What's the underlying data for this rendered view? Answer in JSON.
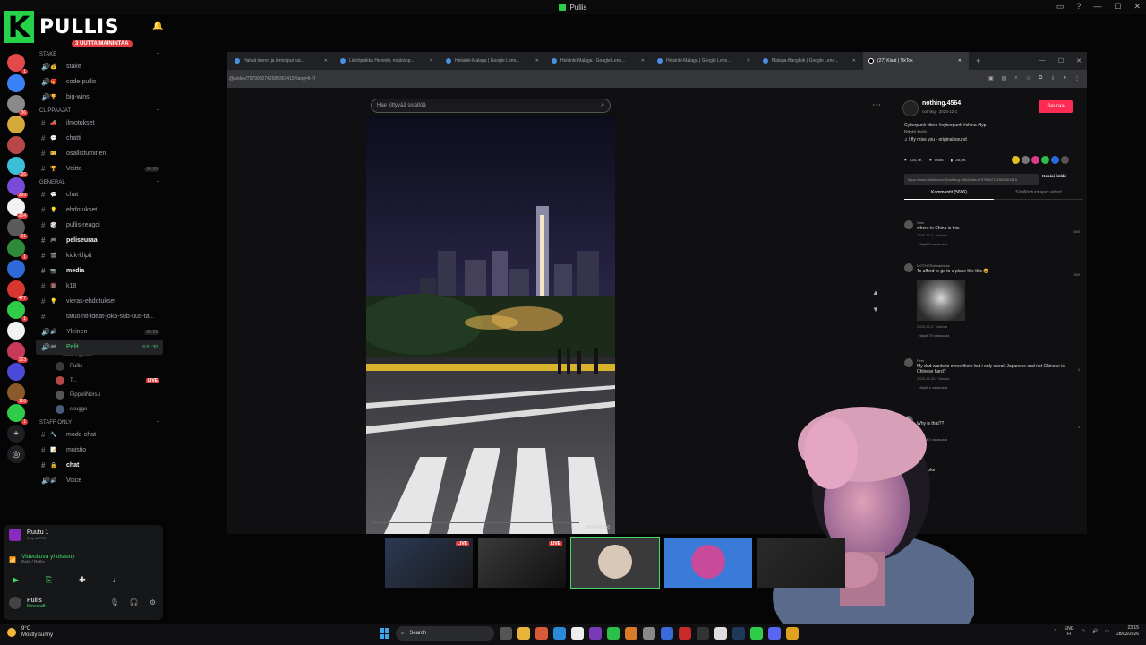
{
  "window": {
    "title": "Pullis",
    "controls": [
      "▭",
      "?",
      "—",
      "☐",
      "✕"
    ]
  },
  "brand": {
    "logo_letter": "K",
    "name": "PULLIS",
    "unread_pill": "3 UUTTA MAININTAA"
  },
  "server_rail": [
    {
      "color": "#e24a4a",
      "badge": "1"
    },
    {
      "color": "#3b82f6",
      "badge": ""
    },
    {
      "color": "#8a8a8a",
      "badge": "36"
    },
    {
      "color": "#d6a93b",
      "badge": ""
    },
    {
      "color": "#b84848",
      "badge": ""
    },
    {
      "color": "#3cc0d8",
      "badge": "26"
    },
    {
      "color": "#7a4ad8",
      "badge": "399"
    },
    {
      "color": "#f2f2f2",
      "badge": "264"
    },
    {
      "color": "#5a5a5a",
      "badge": "91"
    },
    {
      "color": "#2f8a3a",
      "badge": "1"
    },
    {
      "color": "#2f6ad8",
      "badge": ""
    },
    {
      "color": "#d8362f",
      "badge": "477"
    },
    {
      "color": "#2fcc4a",
      "badge": "1"
    },
    {
      "color": "#f2f2f2",
      "badge": ""
    },
    {
      "color": "#c83a5a",
      "badge": "163"
    },
    {
      "color": "#4a4ad8",
      "badge": ""
    },
    {
      "color": "#8a5a2a",
      "badge": "116"
    },
    {
      "color": "#2fcc4a",
      "badge": "1"
    }
  ],
  "channel_sections": [
    {
      "category": "Stake",
      "channels": [
        {
          "icon": "speaker",
          "emoji": "💰",
          "name": "stake"
        },
        {
          "icon": "speaker",
          "emoji": "🎁",
          "name": "code-pullis"
        },
        {
          "icon": "speaker",
          "emoji": "🏆",
          "name": "big-wins"
        }
      ]
    },
    {
      "category": "CLIPPAAJAT",
      "channels": [
        {
          "icon": "hash",
          "emoji": "📣",
          "name": "ilmotukset"
        },
        {
          "icon": "hash",
          "emoji": "💬",
          "name": "chatti"
        },
        {
          "icon": "hash",
          "emoji": "🎫",
          "name": "osallistuminen"
        },
        {
          "icon": "hash",
          "emoji": "🏆",
          "name": "Voitto",
          "count": "00:99"
        }
      ]
    },
    {
      "category": "GENERAL",
      "channels": [
        {
          "icon": "hash",
          "emoji": "💬",
          "name": "chat"
        },
        {
          "icon": "hash",
          "emoji": "💡",
          "name": "ehdotukset"
        },
        {
          "icon": "hash",
          "emoji": "🎲",
          "name": "pullis-reagoi"
        },
        {
          "icon": "hash",
          "emoji": "🎮",
          "name": "peliseuraa",
          "bold": true
        },
        {
          "icon": "hash",
          "emoji": "🎬",
          "name": "kick-klipit"
        },
        {
          "icon": "hash",
          "emoji": "📷",
          "name": "media",
          "bold": true
        },
        {
          "icon": "hash",
          "emoji": "🔞",
          "name": "k18"
        },
        {
          "icon": "hash",
          "emoji": "💡",
          "name": "vieras-ehdotukset"
        },
        {
          "icon": "hash",
          "emoji": "",
          "name": "tatuointi-ideat-joka-sub-uus-ta..."
        },
        {
          "icon": "speaker",
          "emoji": "🔊",
          "name": "Yleinen",
          "count": "00:99"
        },
        {
          "icon": "speaker",
          "emoji": "🎮",
          "name": "Pelit",
          "active": true,
          "count": "6:01:30",
          "sub": "discord.gg/kark"
        }
      ]
    }
  ],
  "voice_users": [
    {
      "name": "Pullis",
      "live": false,
      "color": "#3a3a3a"
    },
    {
      "name": "T...",
      "live": true,
      "color": "#b84848"
    },
    {
      "name": "PippeliNorsu",
      "live": false,
      "color": "#555"
    },
    {
      "name": "skugge",
      "live": false,
      "color": "#4a5a7a"
    }
  ],
  "live_label": "LIVE",
  "staff_section": {
    "category": "STAFF ONLY",
    "channels": [
      {
        "icon": "hash",
        "emoji": "🔧",
        "name": "mode-chat"
      },
      {
        "icon": "hash",
        "emoji": "📝",
        "name": "muistio"
      },
      {
        "icon": "hash",
        "emoji": "🔒",
        "name": "chat",
        "bold": true
      },
      {
        "icon": "speaker",
        "emoji": "🔊",
        "name": "Voice"
      }
    ]
  },
  "voice_panel": {
    "server": "Ruutu 1",
    "server_sub": "Etsy at PFA",
    "status": "Videokuva yhdistetty",
    "status_sub": "Pelit / Pullis",
    "user": "Pullis",
    "activity": "Minecraft"
  },
  "browser": {
    "tabs": [
      "Halvat lennot ja lentoliput kai...",
      "Lähtöpaikka Helsinki, määränp...",
      "Helsinki-Malaga | Google Lenn...",
      "Helsinki-Malaga | Google Lenn...",
      "Helsinki-Malaga | Google Lenn...",
      "Malaga-Bangkok | Google Lenn...",
      "(27) Kisat | TikTok"
    ],
    "url": "@/video/7579002742589361415?lang=fi-FI",
    "search_placeholder": "Hae liittyvää sisältöä",
    "video_time": "00:04/00:56"
  },
  "tiktok": {
    "username": "nothing.4564",
    "handle": "nothing · 2025-12-1",
    "follow": "Seuraa",
    "description": "Cyberpunk vibes #cyberpunk #china #fyp",
    "description_more": "Näytä lisää",
    "music": "♫ I fly miss you - original sound",
    "stats": [
      "434,7K",
      "5666",
      "35,8K"
    ],
    "link": "https://www.tiktok.com/@nothing.4564/video/7579002742589361415",
    "copy_link": "Kopioi linkki",
    "tab_comments": "Kommentit (5696)",
    "tab_creator": "Sisällöntuottajan videot",
    "comments": [
      {
        "name": "Sam",
        "text": "where in China is this",
        "meta": "2025-12-3 · Vastaa",
        "replies": "Näytä 9 vastausta",
        "likes": "580"
      },
      {
        "name": "MOTHERofmadness",
        "text": "To afford to go to a place like this 😂",
        "meta": "2025-12-3 · Vastaa",
        "replies": "Näytä 70 vastausta",
        "likes": "359"
      },
      {
        "name": "Pete",
        "text": "My dad wants to move there but i only speak Japanese and not Chinese is Chinese hard?",
        "meta": "2025-12-30 · Vastaa",
        "replies": "Näytä 4 vastausta",
        "likes": "4"
      },
      {
        "name": "",
        "text": "Why is that??",
        "meta": "",
        "replies": "Näytä 3 vastausta",
        "likes": "3"
      },
      {
        "name": "",
        "text": "I'm broke",
        "meta": "",
        "replies": "",
        "likes": ""
      }
    ]
  },
  "thumbnails": [
    {
      "type": "stream",
      "live": true,
      "colors": [
        "#2b3a55",
        "#1a1a1c"
      ]
    },
    {
      "type": "stream",
      "live": true,
      "colors": [
        "#3a3a3a",
        "#101010"
      ]
    },
    {
      "type": "avatar",
      "live": false,
      "colors": [
        "#d9c7b8",
        "#3a3a3a"
      ]
    },
    {
      "type": "avatar",
      "live": false,
      "colors": [
        "#c84a9a",
        "#3a7ad8"
      ]
    },
    {
      "type": "blank",
      "live": false,
      "colors": [
        "#2a2a2a",
        "#1a1a1a"
      ]
    }
  ],
  "taskbar": {
    "weather_temp": "9°C",
    "weather_text": "Mostly sunny",
    "search": "Search",
    "lang": "ENG",
    "lang_sub": "FI",
    "time": "23.15",
    "date": "28/03/2026"
  }
}
